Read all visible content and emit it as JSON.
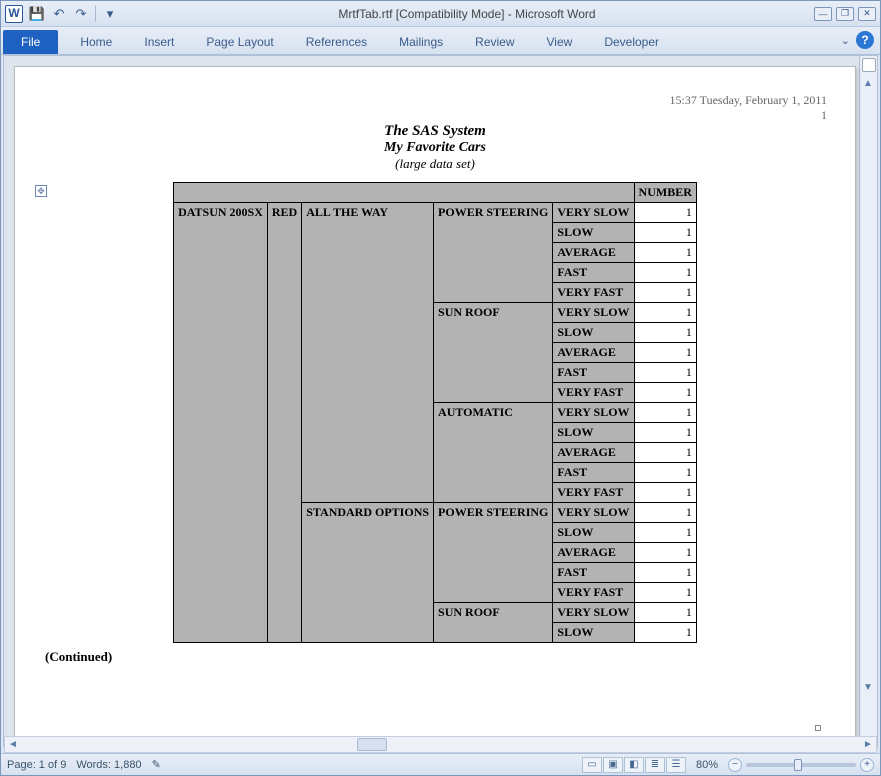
{
  "app": {
    "icon_letter": "W",
    "title": "MrtfTab.rtf [Compatibility Mode]  -  Microsoft Word"
  },
  "qat": {
    "save": "💾",
    "undo": "↶",
    "redo": "↷",
    "customize": "▾"
  },
  "window_controls": {
    "min": "—",
    "restore": "❐",
    "close": "✕"
  },
  "ribbon": {
    "file": "File",
    "tabs": [
      "Home",
      "Insert",
      "Page Layout",
      "References",
      "Mailings",
      "Review",
      "View",
      "Developer"
    ],
    "help": "?"
  },
  "page_header": {
    "timestamp": "15:37  Tuesday, February 1, 2011",
    "page_no": "1"
  },
  "doc": {
    "title": "The SAS System",
    "subtitle": "My Favorite Cars",
    "note": "(large data set)",
    "continued": "(Continued)"
  },
  "table": {
    "number_header": "NUMBER",
    "col1": "DATSUN 200SX",
    "col2": "RED",
    "groups": [
      "ALL THE WAY",
      "STANDARD OPTIONS"
    ],
    "subgroups": [
      "POWER STEERING",
      "SUN ROOF",
      "AUTOMATIC",
      "POWER STEERING",
      "SUN ROOF"
    ],
    "speeds": [
      "VERY SLOW",
      "SLOW",
      "AVERAGE",
      "FAST",
      "VERY FAST"
    ],
    "short_speeds": [
      "VERY SLOW",
      "SLOW"
    ],
    "val": "1"
  },
  "status": {
    "page": "Page: 1 of 9",
    "words": "Words: 1,880",
    "lang_icon": "✎",
    "zoom_pct": "80%",
    "minus": "−",
    "plus": "+"
  },
  "scroll": {
    "left": "◄",
    "right": "►",
    "up": "▲",
    "down": "▼"
  }
}
